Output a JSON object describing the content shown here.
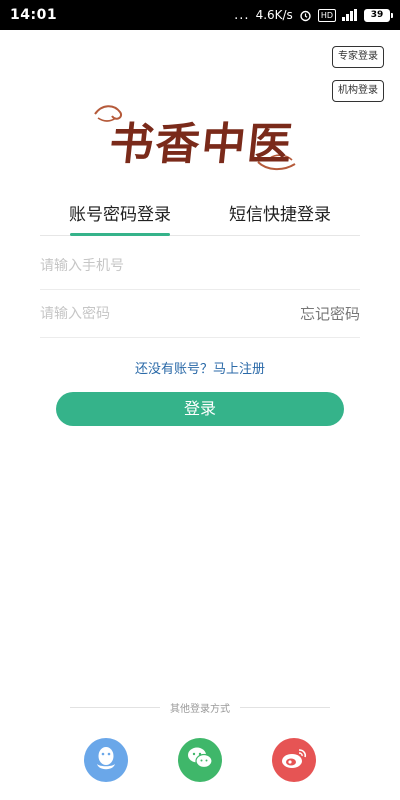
{
  "status_bar": {
    "time": "14:01",
    "dots": "...",
    "speed": "4.6K/s",
    "sim_label": "HD",
    "battery": "39"
  },
  "corner_buttons": {
    "expert_login": "专家登录",
    "org_login": "机构登录"
  },
  "logo": {
    "text": "书香中医"
  },
  "tabs": [
    {
      "label": "账号密码登录",
      "active": true
    },
    {
      "label": "短信快捷登录",
      "active": false
    }
  ],
  "form": {
    "phone_placeholder": "请输入手机号",
    "password_placeholder": "请输入密码",
    "forgot_password": "忘记密码",
    "register_link": "还没有账号？马上注册",
    "login_button": "登录"
  },
  "other_login": {
    "label": "其他登录方式",
    "icons": [
      "qq-icon",
      "wechat-icon",
      "weibo-icon"
    ]
  },
  "colors": {
    "accent": "#35b38a",
    "link": "#2b6aa8",
    "logo": "#7a2a1a",
    "qq": "#6aa7e9",
    "wechat": "#3fb76a",
    "weibo": "#e65454"
  }
}
